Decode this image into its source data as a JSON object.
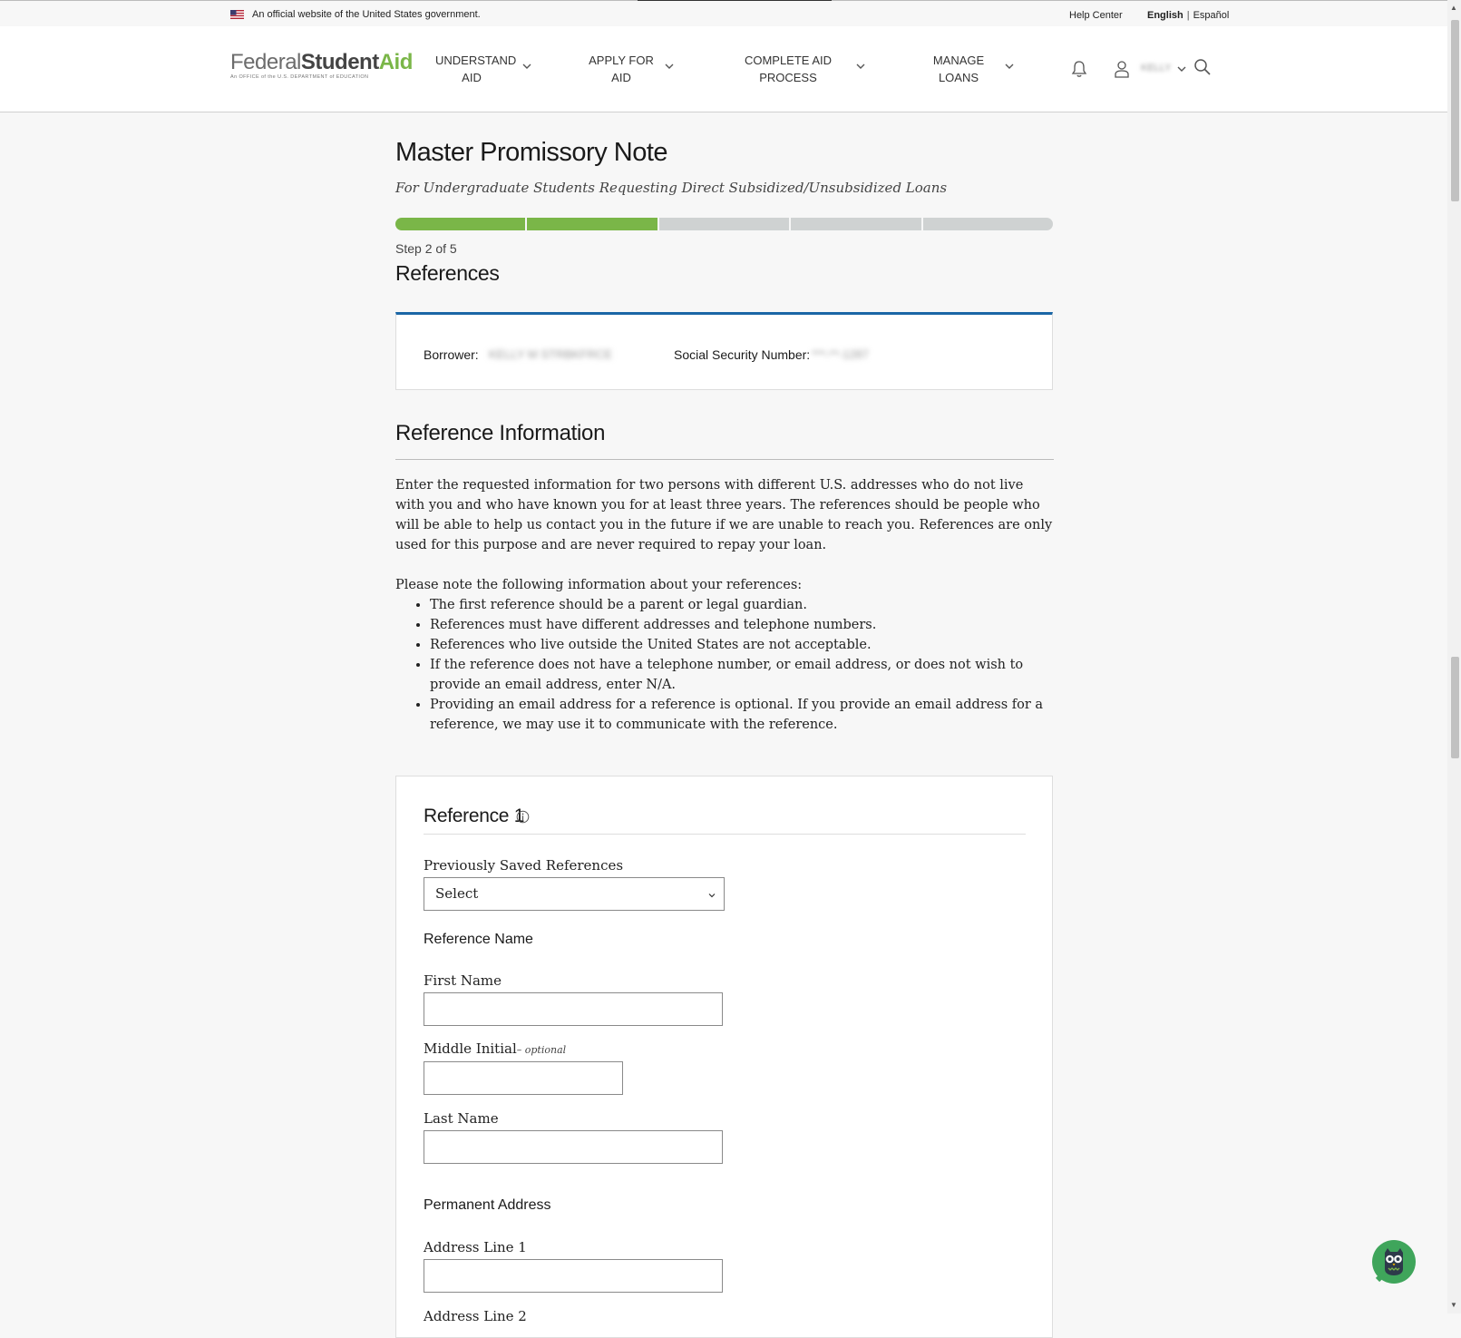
{
  "gov_banner": {
    "text": "An official website of the United States government.",
    "help_center": "Help Center",
    "lang_english": "English",
    "lang_separator": "|",
    "lang_spanish": "Español"
  },
  "header": {
    "logo_federal": "Federal",
    "logo_student": "Student",
    "logo_aid": "Aid",
    "logo_tagline": "An OFFICE of the U.S. DEPARTMENT of EDUCATION",
    "nav": [
      {
        "line1": "UNDERSTAND",
        "line2": "AID"
      },
      {
        "line1": "APPLY FOR",
        "line2": "AID"
      },
      {
        "line1": "COMPLETE AID",
        "line2": "PROCESS"
      },
      {
        "line1": "MANAGE",
        "line2": "LOANS"
      }
    ],
    "user_name": "KELLY",
    "icons": [
      "bell-icon",
      "user-icon",
      "chevron-down-icon",
      "search-icon"
    ]
  },
  "page": {
    "title": "Master Promissory Note",
    "subtitle": "For Undergraduate Students Requesting Direct Subsidized/Unsubsidized Loans",
    "progress": {
      "current": 2,
      "total": 5
    },
    "step_label": "Step 2 of 5",
    "step_title": "References"
  },
  "borrower": {
    "borrower_label": "Borrower:",
    "borrower_value": "KELLY M STRBKFRCE",
    "ssn_label": "Social Security Number:",
    "ssn_value": "***-**-1287"
  },
  "reference_info": {
    "heading": "Reference Information",
    "intro": "Enter the requested information for two persons with different U.S. addresses who do not live with you and who have known you for at least three years. The references should be people who will be able to help us contact you in the future if we are unable to reach you. References are only used for this purpose and are never required to repay your loan.",
    "note_intro": "Please note the following information about your references:",
    "notes": [
      "The first reference should be a parent or legal guardian.",
      "References must have different addresses and telephone numbers.",
      "References who live outside the United States are not acceptable.",
      "If the reference does not have a telephone number, or email address, or does not wish to provide an email address, enter N/A.",
      "Providing an email address for a reference is optional. If you provide an email address for a reference, we may use it to communicate with the reference."
    ]
  },
  "reference1": {
    "title": "Reference 1",
    "saved_label": "Previously Saved References",
    "saved_value": "Select",
    "name_heading": "Reference Name",
    "first_name_label": "First Name",
    "first_name_value": "",
    "middle_initial_label": "Middle Initial",
    "middle_initial_optional": "– optional",
    "middle_initial_value": "",
    "last_name_label": "Last Name",
    "last_name_value": "",
    "address_heading": "Permanent Address",
    "address1_label": "Address Line 1",
    "address1_value": "",
    "address2_label": "Address Line 2"
  },
  "colors": {
    "accent_green": "#7ab648",
    "accent_blue": "#1b66a6",
    "progress_inactive": "#cfd2d2"
  }
}
